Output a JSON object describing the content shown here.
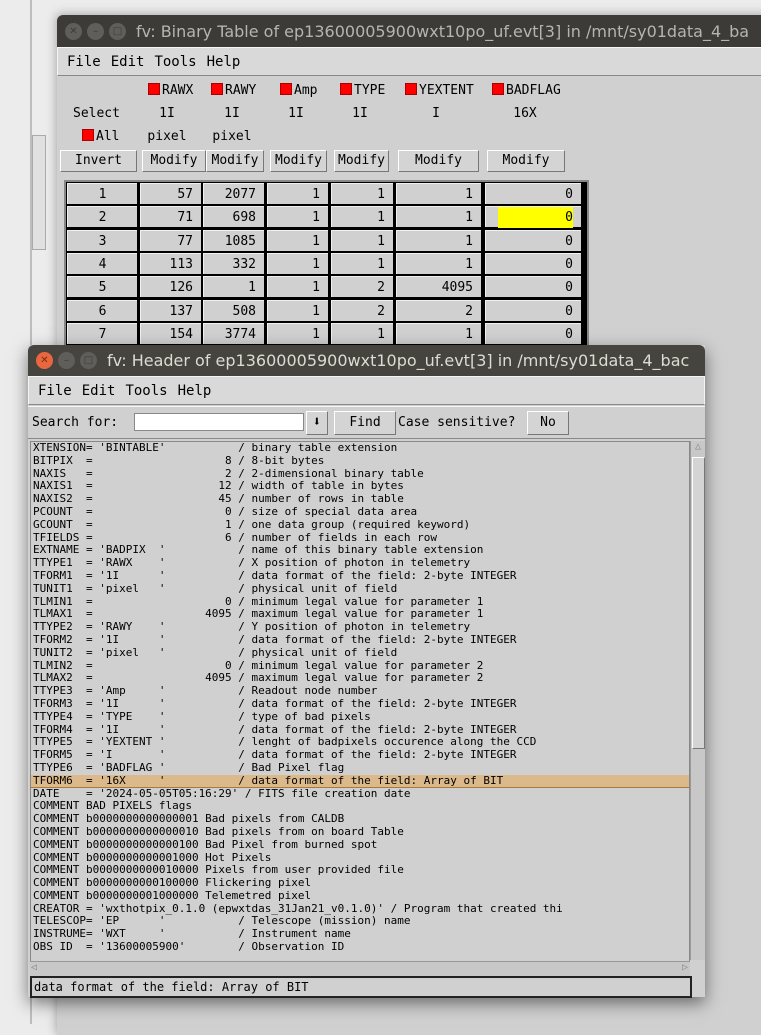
{
  "table_window": {
    "title": "fv: Binary Table of ep13600005900wxt10po_uf.evt[3] in /mnt/sy01data_4_ba",
    "menu": [
      "File",
      "Edit",
      "Tools",
      "Help"
    ],
    "select_label": "Select",
    "all_label": "All",
    "invert_label": "Invert",
    "modify_label": "Modify",
    "columns": [
      {
        "name": "RAWX",
        "format": "1I",
        "unit": "pixel"
      },
      {
        "name": "RAWY",
        "format": "1I",
        "unit": "pixel"
      },
      {
        "name": "Amp",
        "format": "1I",
        "unit": ""
      },
      {
        "name": "TYPE",
        "format": "1I",
        "unit": ""
      },
      {
        "name": "YEXTENT",
        "format": "I",
        "unit": ""
      },
      {
        "name": "BADFLAG",
        "format": "16X",
        "unit": ""
      }
    ],
    "rows": [
      [
        "1",
        "57",
        "2077",
        "1",
        "1",
        "1",
        "0"
      ],
      [
        "2",
        "71",
        "698",
        "1",
        "1",
        "1",
        "0"
      ],
      [
        "3",
        "77",
        "1085",
        "1",
        "1",
        "1",
        "0"
      ],
      [
        "4",
        "113",
        "332",
        "1",
        "1",
        "1",
        "0"
      ],
      [
        "5",
        "126",
        "1",
        "1",
        "2",
        "4095",
        "0"
      ],
      [
        "6",
        "137",
        "508",
        "1",
        "2",
        "2",
        "0"
      ],
      [
        "7",
        "154",
        "3774",
        "1",
        "1",
        "1",
        "0"
      ]
    ],
    "selected_cell_color": "#ffff00",
    "checkbox_color": "#ff0000"
  },
  "header_window": {
    "title": "fv: Header of ep13600005900wxt10po_uf.evt[3] in /mnt/sy01data_4_bac",
    "menu": [
      "File",
      "Edit",
      "Tools",
      "Help"
    ],
    "search_label": "Search for:",
    "search_value": "",
    "find_label": "Find",
    "case_label": "Case sensitive?",
    "case_value": "No",
    "highlighted_line_index": 26,
    "highlight_color": "#dcb98a",
    "lines": [
      "XTENSION= 'BINTABLE'           / binary table extension",
      "BITPIX  =                    8 / 8-bit bytes",
      "NAXIS   =                    2 / 2-dimensional binary table",
      "NAXIS1  =                   12 / width of table in bytes",
      "NAXIS2  =                   45 / number of rows in table",
      "PCOUNT  =                    0 / size of special data area",
      "GCOUNT  =                    1 / one data group (required keyword)",
      "TFIELDS =                    6 / number of fields in each row",
      "EXTNAME = 'BADPIX  '           / name of this binary table extension",
      "TTYPE1  = 'RAWX    '           / X position of photon in telemetry",
      "TFORM1  = '1I      '           / data format of the field: 2-byte INTEGER",
      "TUNIT1  = 'pixel   '           / physical unit of field",
      "TLMIN1  =                    0 / minimum legal value for parameter 1",
      "TLMAX1  =                 4095 / maximum legal value for parameter 1",
      "TTYPE2  = 'RAWY    '           / Y position of photon in telemetry",
      "TFORM2  = '1I      '           / data format of the field: 2-byte INTEGER",
      "TUNIT2  = 'pixel   '           / physical unit of field",
      "TLMIN2  =                    0 / minimum legal value for parameter 2",
      "TLMAX2  =                 4095 / maximum legal value for parameter 2",
      "TTYPE3  = 'Amp     '           / Readout node number",
      "TFORM3  = '1I      '           / data format of the field: 2-byte INTEGER",
      "TTYPE4  = 'TYPE    '           / type of bad pixels",
      "TFORM4  = '1I      '           / data format of the field: 2-byte INTEGER",
      "TTYPE5  = 'YEXTENT '           / lenght of badpixels occurence along the CCD",
      "TFORM5  = 'I       '           / data format of the field: 2-byte INTEGER",
      "TTYPE6  = 'BADFLAG '           / Bad Pixel flag",
      "TFORM6  = '16X     '           / data format of the field: Array of BIT",
      "DATE    = '2024-05-05T05:16:29' / FITS file creation date",
      "COMMENT BAD PIXELS flags",
      "COMMENT b0000000000000001 Bad pixels from CALDB",
      "COMMENT b0000000000000010 Bad pixels from on board Table",
      "COMMENT b0000000000000100 Bad Pixel from burned spot",
      "COMMENT b0000000000001000 Hot Pixels",
      "COMMENT b0000000000010000 Pixels from user provided file",
      "COMMENT b0000000000100000 Flickering pixel",
      "COMMENT b0000000001000000 Telemetred pixel",
      "CREATOR = 'wxthotpix_0.1.0 (epwxtdas_31Jan21_v0.1.0)' / Program that created thi",
      "TELESCOP= 'EP      '           / Telescope (mission) name",
      "INSTRUME= 'WXT     '           / Instrument name",
      "OBS ID  = '13600005900'        / Observation ID"
    ],
    "status_text": "data format of the field: Array of BIT"
  }
}
